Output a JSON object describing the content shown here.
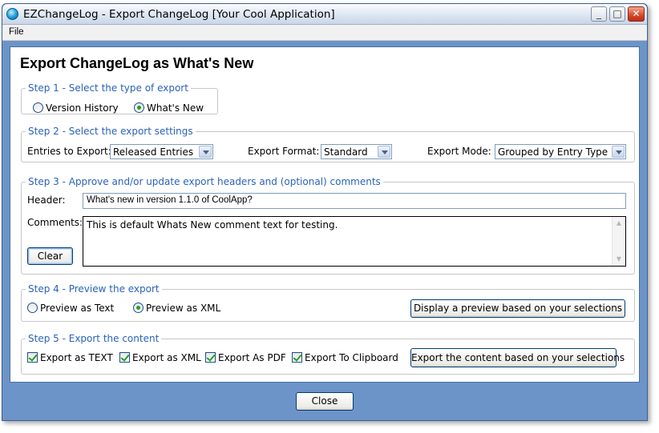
{
  "window": {
    "title": "EZChangeLog - Export ChangeLog [Your Cool Application]",
    "minimize_glyph": "_",
    "maximize_glyph": "□",
    "close_glyph": "✕"
  },
  "menu": {
    "file": "File"
  },
  "page_title": "Export ChangeLog as What's New",
  "step1": {
    "legend": "Step 1 - Select the type of export",
    "options": [
      {
        "label": "Version History",
        "checked": false
      },
      {
        "label": "What's New",
        "checked": true
      }
    ]
  },
  "step2": {
    "legend": "Step 2 - Select the export settings",
    "entries_label": "Entries to Export:",
    "entries_value": "Released Entries",
    "format_label": "Export Format:",
    "format_value": "Standard",
    "mode_label": "Export Mode:",
    "mode_value": "Grouped by Entry Type"
  },
  "step3": {
    "legend": "Step 3 - Approve and/or update export headers and (optional) comments",
    "header_label": "Header:",
    "header_value": "What's new in version 1.1.0 of CoolApp?",
    "comments_label": "Comments:",
    "comments_value": "This is default Whats New comment text for testing.",
    "clear_button": "Clear"
  },
  "step4": {
    "legend": "Step 4 - Preview the export",
    "options": [
      {
        "label": "Preview as Text",
        "checked": false
      },
      {
        "label": "Preview as XML",
        "checked": true
      }
    ],
    "preview_button": "Display a preview based on your selections"
  },
  "step5": {
    "legend": "Step 5 - Export the content",
    "checks": [
      {
        "label": "Export as TEXT",
        "checked": true
      },
      {
        "label": "Export as XML",
        "checked": true
      },
      {
        "label": "Export As PDF",
        "checked": true
      },
      {
        "label": "Export To Clipboard",
        "checked": true
      }
    ],
    "export_button": "Export the content based on your selections"
  },
  "footer": {
    "close_button": "Close"
  },
  "colors": {
    "legend": "#2a62b8",
    "frame": "#6d94c9",
    "radio_dot": "#21a121"
  },
  "icons": [
    "app-icon",
    "minimize-icon",
    "maximize-icon",
    "close-icon",
    "chevron-down-icon",
    "scroll-up-icon",
    "scroll-down-icon"
  ]
}
